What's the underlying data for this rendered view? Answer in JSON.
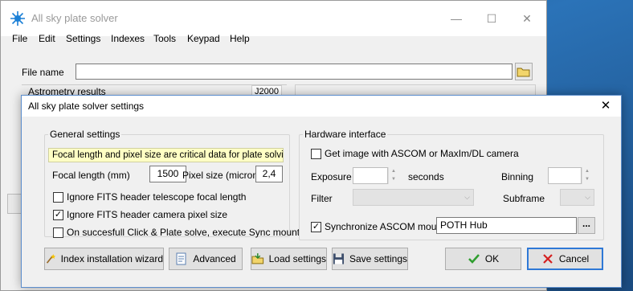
{
  "main_window": {
    "title": "All sky plate solver",
    "menu": [
      "File",
      "Edit",
      "Settings",
      "Indexes",
      "Tools",
      "Keypad",
      "Help"
    ],
    "file_name_label": "File name",
    "file_name_value": "",
    "astrometry_label": "Astrometry results",
    "epoch": "J2000"
  },
  "dialog": {
    "title": "All sky plate solver settings",
    "general": {
      "legend": "General settings",
      "warning": "Focal length and pixel size are critical data for plate solving",
      "focal_length_label": "Focal length (mm)",
      "focal_length_value": "1500",
      "pixel_size_label": "Pixel size (micron)",
      "pixel_size_value": "2,4",
      "options": [
        {
          "label": "Ignore FITS header telescope focal length",
          "checked": false
        },
        {
          "label": "Ignore FITS header camera pixel size",
          "checked": true
        },
        {
          "label": "On succesfull Click & Plate solve, execute Sync mount",
          "checked": false
        }
      ]
    },
    "hardware": {
      "legend": "Hardware interface",
      "get_image_label": "Get image with ASCOM or MaxIm/DL camera",
      "get_image_checked": false,
      "exposure_label": "Exposure",
      "exposure_value": "",
      "seconds_label": "seconds",
      "binning_label": "Binning",
      "binning_value": "",
      "filter_label": "Filter",
      "filter_value": "",
      "subframe_label": "Subframe",
      "subframe_value": "",
      "sync_label": "Synchronize ASCOM mount",
      "sync_checked": true,
      "mount_value": "POTH Hub",
      "ellipsis": "..."
    },
    "buttons": {
      "index_wizard": "Index installation wizard",
      "advanced": "Advanced",
      "load": "Load settings",
      "save": "Save settings",
      "ok": "OK",
      "cancel": "Cancel"
    }
  }
}
